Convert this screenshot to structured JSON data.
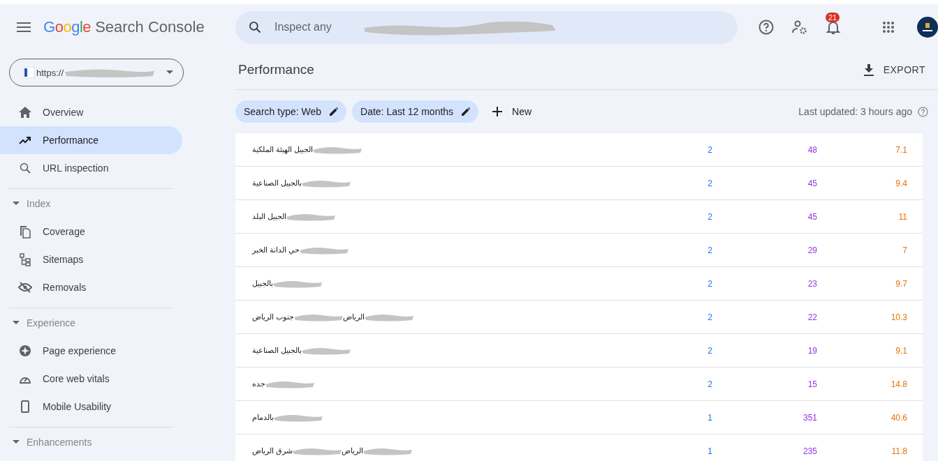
{
  "app": {
    "title_brand": "Google",
    "title_product": "Search Console"
  },
  "search": {
    "placeholder": "Inspect any"
  },
  "notifications": {
    "count": "21"
  },
  "property": {
    "text": "https://"
  },
  "sidebar": {
    "items": [
      {
        "kind": "item",
        "label": "Overview",
        "selected": false
      },
      {
        "kind": "item",
        "label": "Performance",
        "selected": true
      },
      {
        "kind": "item",
        "label": "URL inspection",
        "selected": false
      },
      {
        "kind": "section",
        "label": "Index",
        "expanded": true
      },
      {
        "kind": "item",
        "label": "Coverage",
        "selected": false
      },
      {
        "kind": "item",
        "label": "Sitemaps",
        "selected": false
      },
      {
        "kind": "item",
        "label": "Removals",
        "selected": false
      },
      {
        "kind": "section",
        "label": "Experience",
        "expanded": true
      },
      {
        "kind": "item",
        "label": "Page experience",
        "selected": false
      },
      {
        "kind": "item",
        "label": "Core web vitals",
        "selected": false
      },
      {
        "kind": "item",
        "label": "Mobile Usability",
        "selected": false
      },
      {
        "kind": "section",
        "label": "Enhancements",
        "expanded": true
      }
    ]
  },
  "page": {
    "title": "Performance",
    "export": "EXPORT"
  },
  "filters": [
    {
      "label": "Search type: Web"
    },
    {
      "label": "Date: Last 12 months"
    }
  ],
  "new_button": "New",
  "last_updated": "Last updated: 3 hours ago",
  "table": {
    "columns": [
      {
        "color": "#1a73e8"
      },
      {
        "color": "#9334e6"
      },
      {
        "color": "#e8710a"
      }
    ],
    "rows": [
      {
        "query_parts": [
          "الجبيل الهيئة الملكية"
        ],
        "values": [
          "2",
          "48",
          "7.1"
        ]
      },
      {
        "query_parts": [
          "بالجبيل الصناعية"
        ],
        "values": [
          "2",
          "45",
          "9.4"
        ]
      },
      {
        "query_parts": [
          "الجبيل البلد"
        ],
        "values": [
          "2",
          "45",
          "11"
        ]
      },
      {
        "query_parts": [
          "حي الدانة الخبر"
        ],
        "values": [
          "2",
          "29",
          "7"
        ]
      },
      {
        "query_parts": [
          "بالجبيل"
        ],
        "values": [
          "2",
          "23",
          "9.7"
        ]
      },
      {
        "query_parts": [
          "الرياض",
          "جنوب الرياض"
        ],
        "values": [
          "2",
          "22",
          "10.3"
        ]
      },
      {
        "query_parts": [
          "بالجبيل الصناعية"
        ],
        "values": [
          "2",
          "19",
          "9.1"
        ]
      },
      {
        "query_parts": [
          "جده"
        ],
        "values": [
          "2",
          "15",
          "14.8"
        ]
      },
      {
        "query_parts": [
          "بالدمام"
        ],
        "values": [
          "1",
          "351",
          "40.6"
        ]
      },
      {
        "query_parts": [
          "الرياض",
          "شرق الرياض"
        ],
        "values": [
          "1",
          "235",
          "11.8"
        ]
      }
    ]
  }
}
